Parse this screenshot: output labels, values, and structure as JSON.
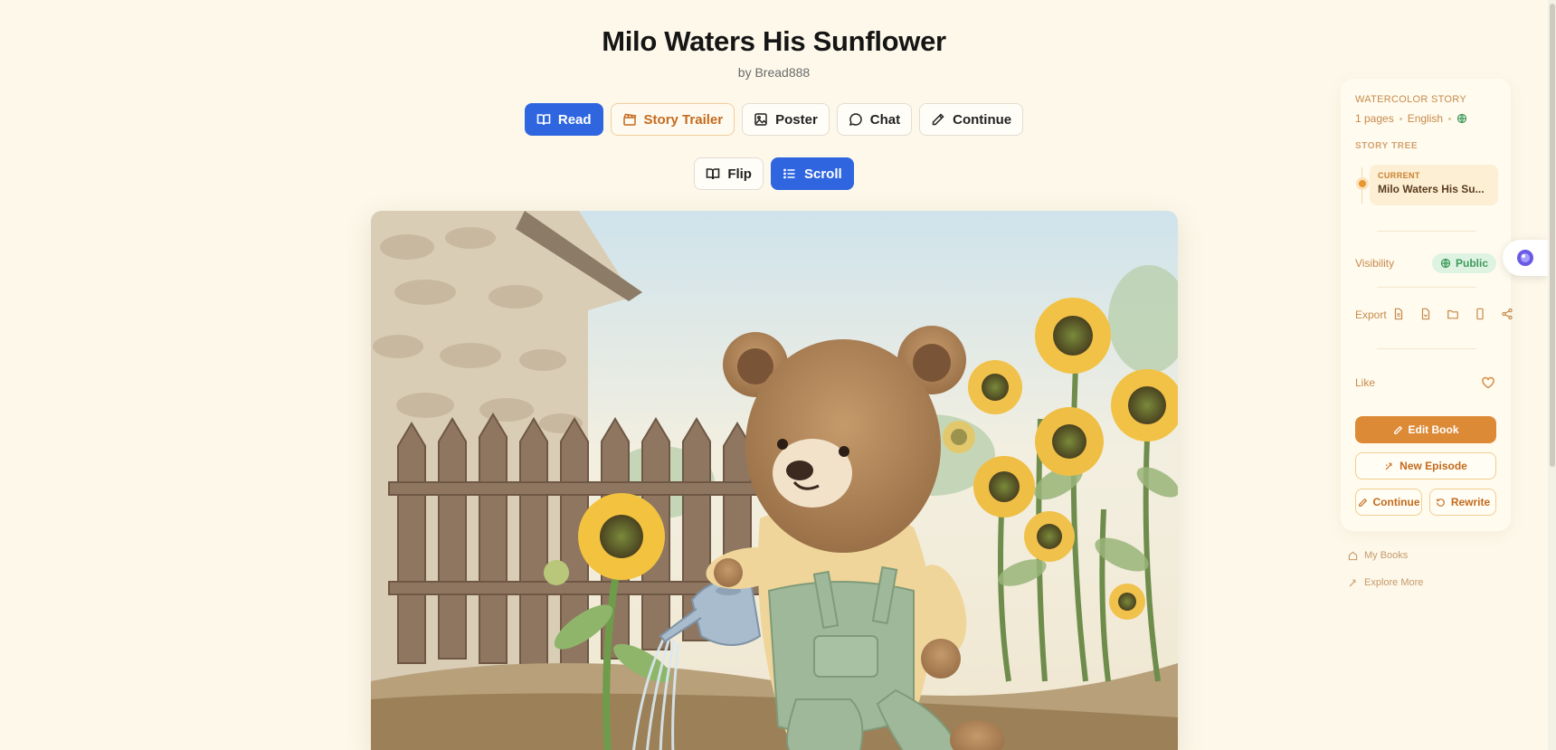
{
  "story": {
    "title": "Milo Waters His Sunflower",
    "byline": "by Bread888"
  },
  "tabs": [
    {
      "label": "Read",
      "icon": "book-open-icon",
      "active": true
    },
    {
      "label": "Story Trailer",
      "icon": "clapperboard-icon",
      "active": false
    },
    {
      "label": "Poster",
      "icon": "image-icon",
      "active": false
    },
    {
      "label": "Chat",
      "icon": "chat-bubble-icon",
      "active": false
    },
    {
      "label": "Continue",
      "icon": "pencil-icon",
      "active": false
    }
  ],
  "view_modes": [
    {
      "label": "Flip",
      "icon": "book-open-icon",
      "active": false
    },
    {
      "label": "Scroll",
      "icon": "list-icon",
      "active": true
    }
  ],
  "illustration": {
    "subject": "watercolor bear in green overalls watering a sunflower"
  },
  "sidebar": {
    "kicker": "WATERCOLOR STORY",
    "pages": "1 pages",
    "language": "English",
    "story_tree_label": "STORY TREE",
    "current_label": "CURRENT",
    "current_title": "Milo Waters His Su...",
    "visibility_label": "Visibility",
    "visibility_value": "Public",
    "export_label": "Export",
    "export_icons": [
      "document-icon",
      "pdf-icon",
      "folder-icon",
      "phone-icon",
      "share-icon"
    ],
    "like_label": "Like",
    "buttons": {
      "edit_book": "Edit Book",
      "new_episode": "New Episode",
      "continue": "Continue",
      "rewrite": "Rewrite"
    }
  },
  "nav": {
    "my_books": "My Books",
    "explore_more": "Explore More"
  },
  "colors": {
    "background": "#fdf8ea",
    "primary": "#2f66e0",
    "accent": "#dd8a36",
    "public_green": "#3f9a5a"
  }
}
